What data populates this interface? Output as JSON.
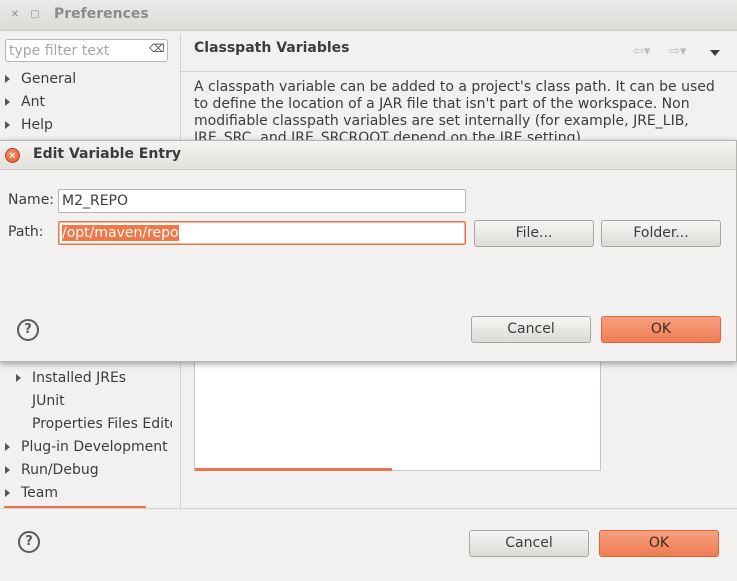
{
  "preferences": {
    "title": "Preferences",
    "filter_placeholder": "type filter text",
    "tree_top": [
      {
        "label": "General",
        "has_children": true
      },
      {
        "label": "Ant",
        "has_children": true
      },
      {
        "label": "Help",
        "has_children": true
      }
    ],
    "tree_bottom": [
      {
        "label": "Installed JREs",
        "has_children": true,
        "indent": 1
      },
      {
        "label": "JUnit",
        "has_children": false,
        "indent": 1
      },
      {
        "label": "Properties Files Edito",
        "has_children": false,
        "indent": 1
      },
      {
        "label": "Plug-in Development",
        "has_children": true,
        "indent": 0
      },
      {
        "label": "Run/Debug",
        "has_children": true,
        "indent": 0
      },
      {
        "label": "Team",
        "has_children": true,
        "indent": 0
      }
    ],
    "page_title": "Classpath Variables",
    "description": "A classpath variable can be added to a project's class path. It can be used to define the location of a JAR file that isn't part of the workspace. Non modifiable classpath variables are set internally (for example, JRE_LIB, JRE_SRC, and JRE_SRCROOT depend on the JRE setting)",
    "help_icon": "?",
    "cancel_label": "Cancel",
    "ok_label": "OK"
  },
  "dialog": {
    "title": "Edit Variable Entry",
    "name_label": "Name:",
    "name_value": "M2_REPO",
    "path_label": "Path:",
    "path_value": "/opt/maven/repo",
    "file_button": "File...",
    "folder_button": "Folder...",
    "help_icon": "?",
    "cancel_label": "Cancel",
    "ok_label": "OK"
  },
  "colors": {
    "accent": "#ef7d53",
    "selection": "#f07746"
  }
}
